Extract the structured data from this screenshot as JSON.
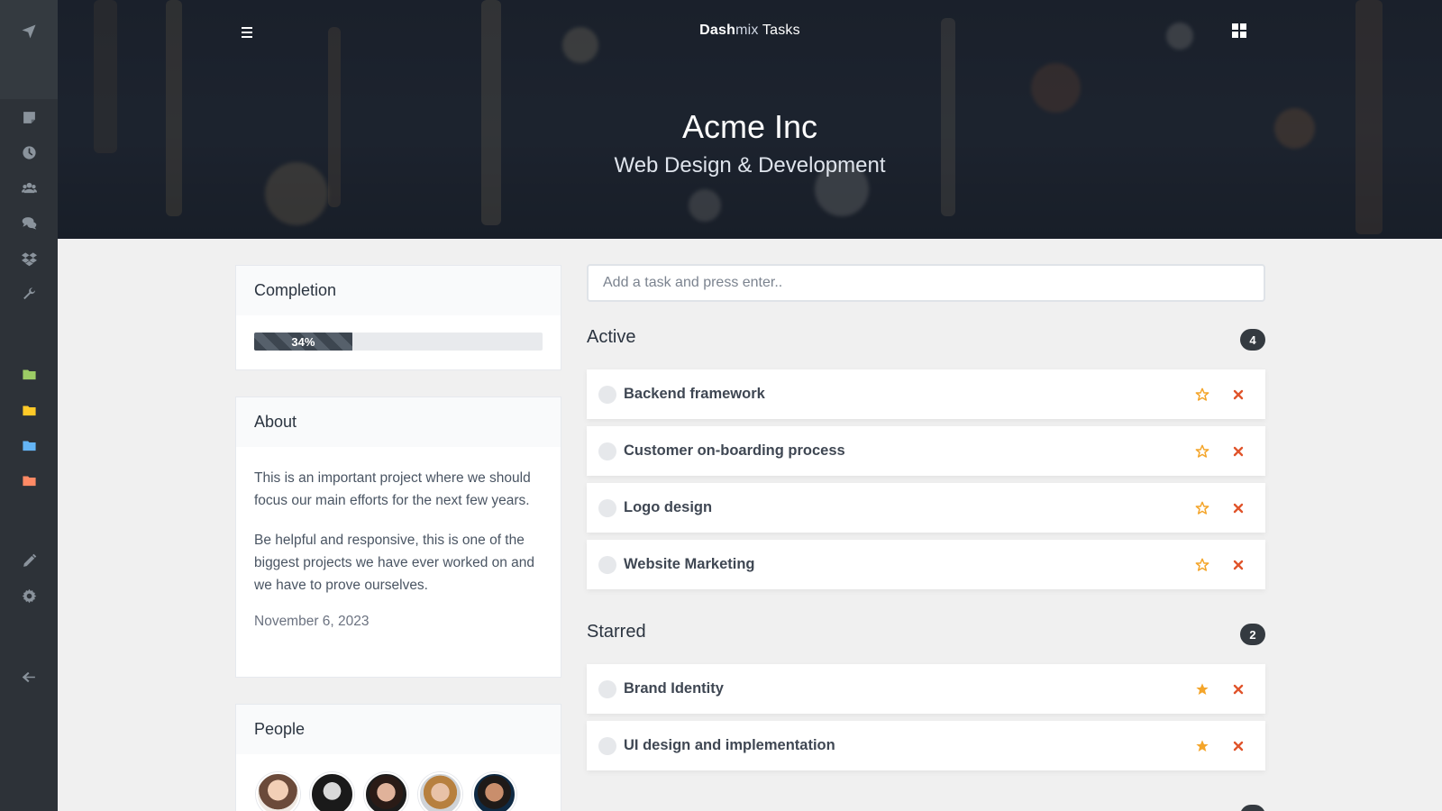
{
  "header": {
    "brand_bold": "Dash",
    "brand_mid": "mix",
    "brand_rest": " Tasks",
    "title": "Acme Inc",
    "subtitle": "Web Design & Development"
  },
  "sidebar": {
    "icons": [
      "paper-plane-icon",
      "sticky-note-icon",
      "clock-icon",
      "users-icon",
      "comments-icon",
      "dropbox-icon",
      "wrench-icon",
      "folder-green-icon",
      "folder-yellow-icon",
      "folder-blue-icon",
      "folder-orange-icon",
      "pencil-icon",
      "gear-icon",
      "arrow-left-icon"
    ],
    "folder_colors": [
      "#9ccc65",
      "#ffca28",
      "#64b5f6",
      "#ff8a65"
    ]
  },
  "completion": {
    "title": "Completion",
    "percent_label": "34%",
    "value": 0.34
  },
  "about": {
    "title": "About",
    "paragraph1": "This is an important project where we should focus our main efforts for the next few years.",
    "paragraph2": "Be helpful and responsive, this is one of the biggest projects we have ever worked on and we have to prove ourselves.",
    "date": "November 6, 2023"
  },
  "people": {
    "title": "People",
    "count": 5
  },
  "task_input": {
    "placeholder": "Add a task and press enter.."
  },
  "active": {
    "title": "Active",
    "count": "4",
    "tasks": [
      "Backend framework",
      "Customer on-boarding process",
      "Logo design",
      "Website Marketing"
    ]
  },
  "starred": {
    "title": "Starred",
    "count": "2",
    "tasks": [
      "Brand Identity",
      "UI design and implementation"
    ]
  },
  "colors": {
    "star": "#f4a52a",
    "delete": "#e0542b",
    "sidebar": "#2d3238"
  }
}
